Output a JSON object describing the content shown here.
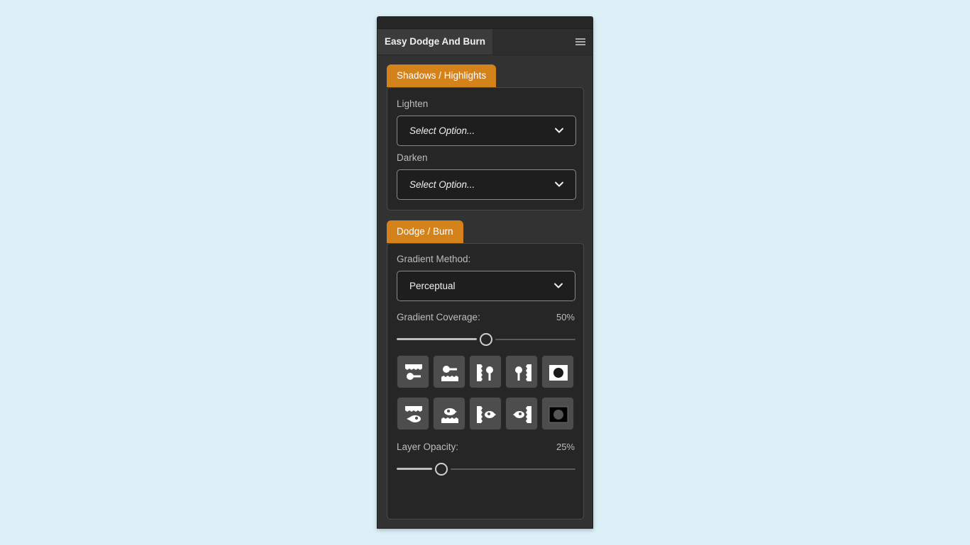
{
  "panel": {
    "title": "Easy Dodge And Burn",
    "menu_icon": "hamburger-menu-icon"
  },
  "shadows_highlights": {
    "tab_label": "Shadows / Highlights",
    "lighten_label": "Lighten",
    "lighten_value": "Select Option...",
    "darken_label": "Darken",
    "darken_value": "Select Option..."
  },
  "dodge_burn": {
    "tab_label": "Dodge / Burn",
    "gradient_method_label": "Gradient Method:",
    "gradient_method_value": "Perceptual",
    "gradient_coverage_label": "Gradient Coverage:",
    "gradient_coverage_value": "50%",
    "gradient_coverage_fraction": 0.5,
    "layer_opacity_label": "Layer Opacity:",
    "layer_opacity_value": "25%",
    "layer_opacity_fraction": 0.25,
    "gradient_buttons": [
      "gradient-top-dodge-icon",
      "gradient-bottom-dodge-icon",
      "gradient-left-dodge-icon",
      "gradient-right-dodge-icon",
      "gradient-vignette-dodge-icon",
      "gradient-top-burn-icon",
      "gradient-bottom-burn-icon",
      "gradient-left-burn-icon",
      "gradient-right-burn-icon",
      "gradient-vignette-burn-icon"
    ]
  },
  "colors": {
    "accent": "#d4821a",
    "panel_bg": "#323232",
    "section_bg": "#262626",
    "page_bg": "#dcf0f8"
  }
}
